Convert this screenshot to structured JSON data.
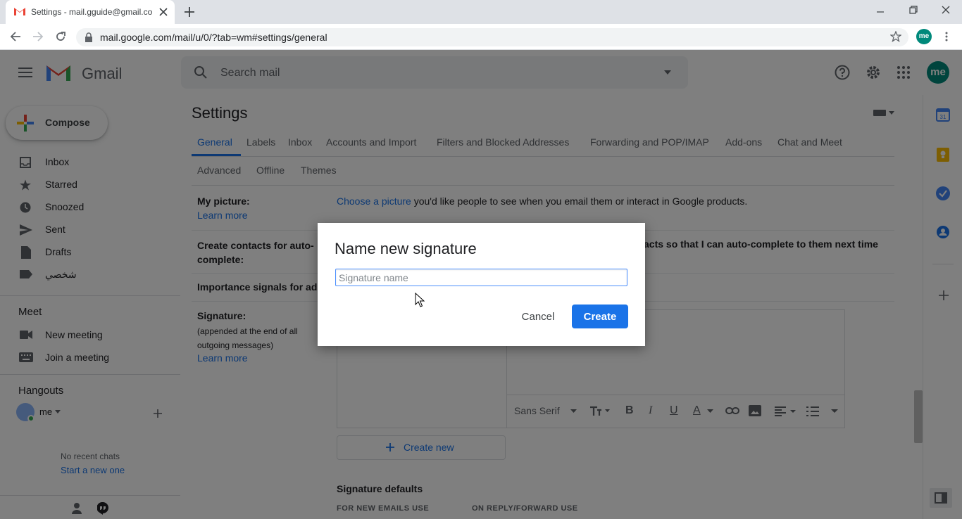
{
  "browser": {
    "tab_title": "Settings - mail.gguide@gmail.co",
    "url": "mail.google.com/mail/u/0/?tab=wm#settings/general",
    "profile_label": "me"
  },
  "gmail": {
    "logo_text": "Gmail",
    "search_placeholder": "Search mail",
    "avatar_label": "me",
    "compose_label": "Compose",
    "nav": [
      {
        "label": "Inbox"
      },
      {
        "label": "Starred"
      },
      {
        "label": "Snoozed"
      },
      {
        "label": "Sent"
      },
      {
        "label": "Drafts"
      },
      {
        "label": "شخصي"
      }
    ],
    "meet": {
      "title": "Meet",
      "new_meeting": "New meeting",
      "join_meeting": "Join a meeting"
    },
    "hangouts": {
      "title": "Hangouts",
      "user": "me",
      "no_chats": "No recent chats",
      "start_new": "Start a new one"
    }
  },
  "settings": {
    "title": "Settings",
    "tabs_row1": [
      "General",
      "Labels",
      "Inbox",
      "Accounts and Import",
      "Filters and Blocked Addresses",
      "Forwarding and POP/IMAP",
      "Add-ons",
      "Chat and Meet"
    ],
    "tabs_row2": [
      "Advanced",
      "Offline",
      "Themes"
    ],
    "my_picture_label": "My picture:",
    "learn_more": "Learn more",
    "choose_picture_link": "Choose a picture",
    "choose_picture_text": " you'd like people to see when you email them or interact in Google products.",
    "create_contacts_label": "Create contacts for auto-complete:",
    "create_contacts_text": "acts so that I can auto-complete to them next time",
    "importance_label": "Importance signals for ads",
    "signature_label": "Signature:",
    "signature_sub": "(appended at the end of all outgoing messages)",
    "signature_learn_more": "Learn more",
    "font_name": "Sans Serif",
    "create_new": "Create new",
    "sig_defaults": "Signature defaults",
    "for_new_emails": "FOR NEW EMAILS USE",
    "on_reply": "ON REPLY/FORWARD USE"
  },
  "dialog": {
    "title": "Name new signature",
    "input_placeholder": "Signature name",
    "input_value": "",
    "cancel": "Cancel",
    "create": "Create"
  },
  "colors": {
    "accent": "#1a73e8",
    "overlay": "rgba(0,0,0,0.5)"
  }
}
